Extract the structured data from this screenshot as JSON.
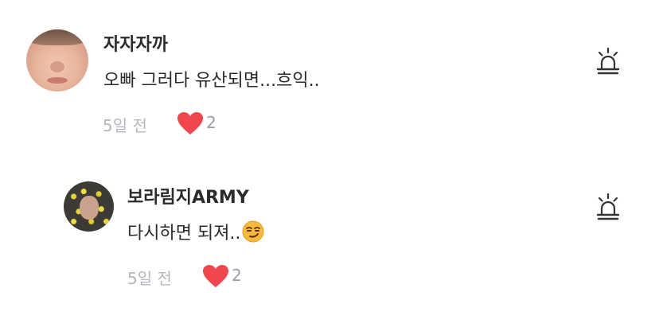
{
  "comments": [
    {
      "username": "자자자까",
      "text": "오빠 그러다 유산되면...흐익..",
      "time": "5일 전",
      "likes": "2",
      "avatar_icon": "user-avatar-photo",
      "report_icon": "siren-icon"
    }
  ],
  "replies": [
    {
      "username": "보라림지ARMY",
      "text": "다시하면 되져..",
      "emoji": "smirking-face-emoji",
      "time": "5일 전",
      "likes": "2",
      "avatar_icon": "user-avatar-photo",
      "report_icon": "siren-icon"
    }
  ],
  "colors": {
    "heart": "#f0474f",
    "meta_text": "#b5b8bf",
    "primary_text": "#2b2b2b"
  }
}
